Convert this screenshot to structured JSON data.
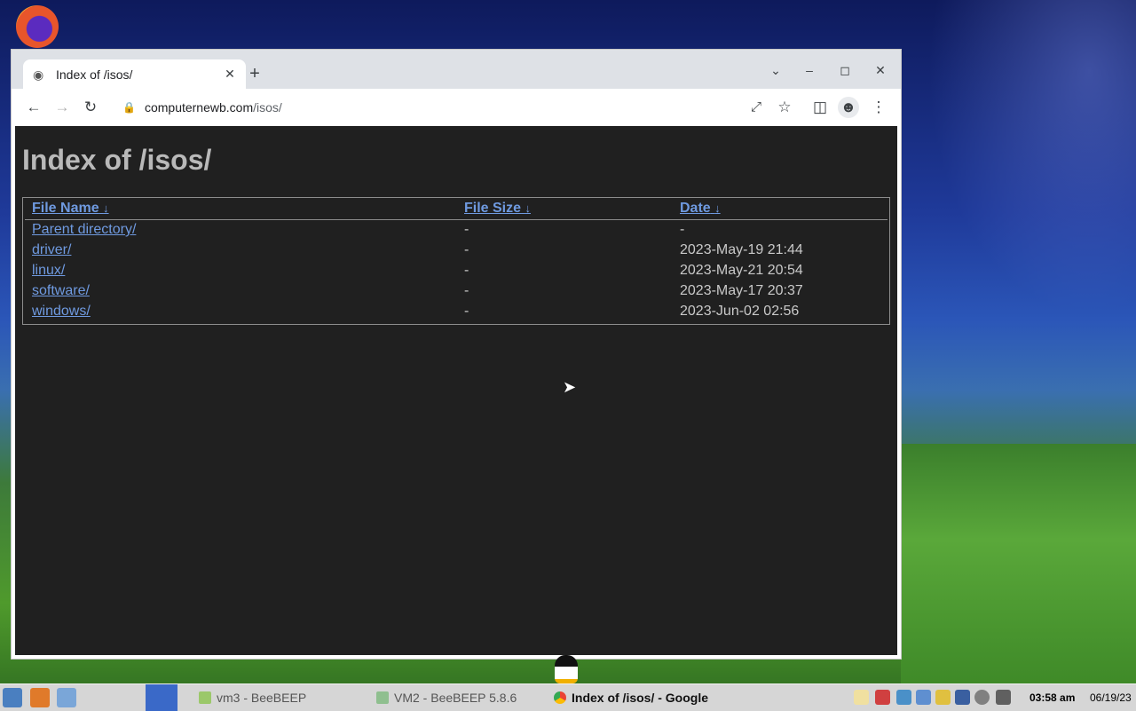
{
  "browser": {
    "tab_title": "Index of /isos/",
    "new_tab": "+",
    "url_host": "computernewb.com",
    "url_path": "/isos/"
  },
  "page": {
    "heading": "Index of /isos/",
    "columns": {
      "name": "File Name",
      "size": "File Size",
      "date": "Date",
      "sort_arrow": "↓"
    },
    "rows": [
      {
        "name": "Parent directory/",
        "size": "-",
        "date": "-"
      },
      {
        "name": "driver/",
        "size": "-",
        "date": "2023-May-19 21:44"
      },
      {
        "name": "linux/",
        "size": "-",
        "date": "2023-May-21 20:54"
      },
      {
        "name": "software/",
        "size": "-",
        "date": "2023-May-17 20:37"
      },
      {
        "name": "windows/",
        "size": "-",
        "date": "2023-Jun-02 02:56"
      }
    ]
  },
  "taskbar": {
    "items": [
      {
        "label": "vm3 - BeeBEEP"
      },
      {
        "label": "VM2 - BeeBEEP 5.8.6"
      },
      {
        "label": "Index of /isos/ - Google"
      }
    ],
    "time": "03:58 am",
    "date": "06/19/23"
  },
  "icons": {
    "tab_favicon": "globe-icon",
    "lock": "lock-icon",
    "share": "share-icon",
    "bookmark": "star-icon",
    "sidepanel": "side-panel-icon",
    "profile": "profile-icon",
    "menu": "kebab-menu-icon"
  },
  "colors": {
    "page_bg": "#202020",
    "link": "#6f9ae0",
    "heading": "#b9b9b9"
  }
}
